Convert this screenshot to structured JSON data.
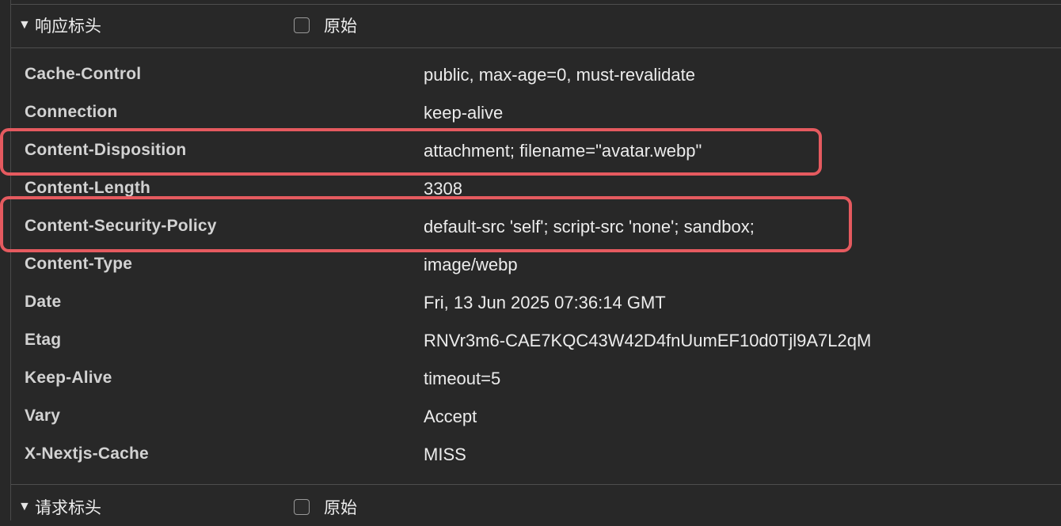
{
  "response_section": {
    "title": "响应标头",
    "raw_label": "原始",
    "raw_checked": false
  },
  "request_section": {
    "title": "请求标头",
    "raw_label": "原始",
    "raw_checked": false
  },
  "headers": [
    {
      "name": "Cache-Control",
      "value": "public, max-age=0, must-revalidate"
    },
    {
      "name": "Connection",
      "value": "keep-alive"
    },
    {
      "name": "Content-Disposition",
      "value": "attachment; filename=\"avatar.webp\""
    },
    {
      "name": "Content-Length",
      "value": "3308"
    },
    {
      "name": "Content-Security-Policy",
      "value": "default-src 'self'; script-src 'none'; sandbox;"
    },
    {
      "name": "Content-Type",
      "value": "image/webp"
    },
    {
      "name": "Date",
      "value": "Fri, 13 Jun 2025 07:36:14 GMT"
    },
    {
      "name": "Etag",
      "value": "RNVr3m6-CAE7KQC43W42D4fnUumEF10d0Tjl9A7L2qM"
    },
    {
      "name": "Keep-Alive",
      "value": "timeout=5"
    },
    {
      "name": "Vary",
      "value": "Accept"
    },
    {
      "name": "X-Nextjs-Cache",
      "value": "MISS"
    }
  ],
  "highlight_color": "#e55a5f",
  "highlighted_headers": [
    "Content-Disposition",
    "Content-Security-Policy"
  ]
}
